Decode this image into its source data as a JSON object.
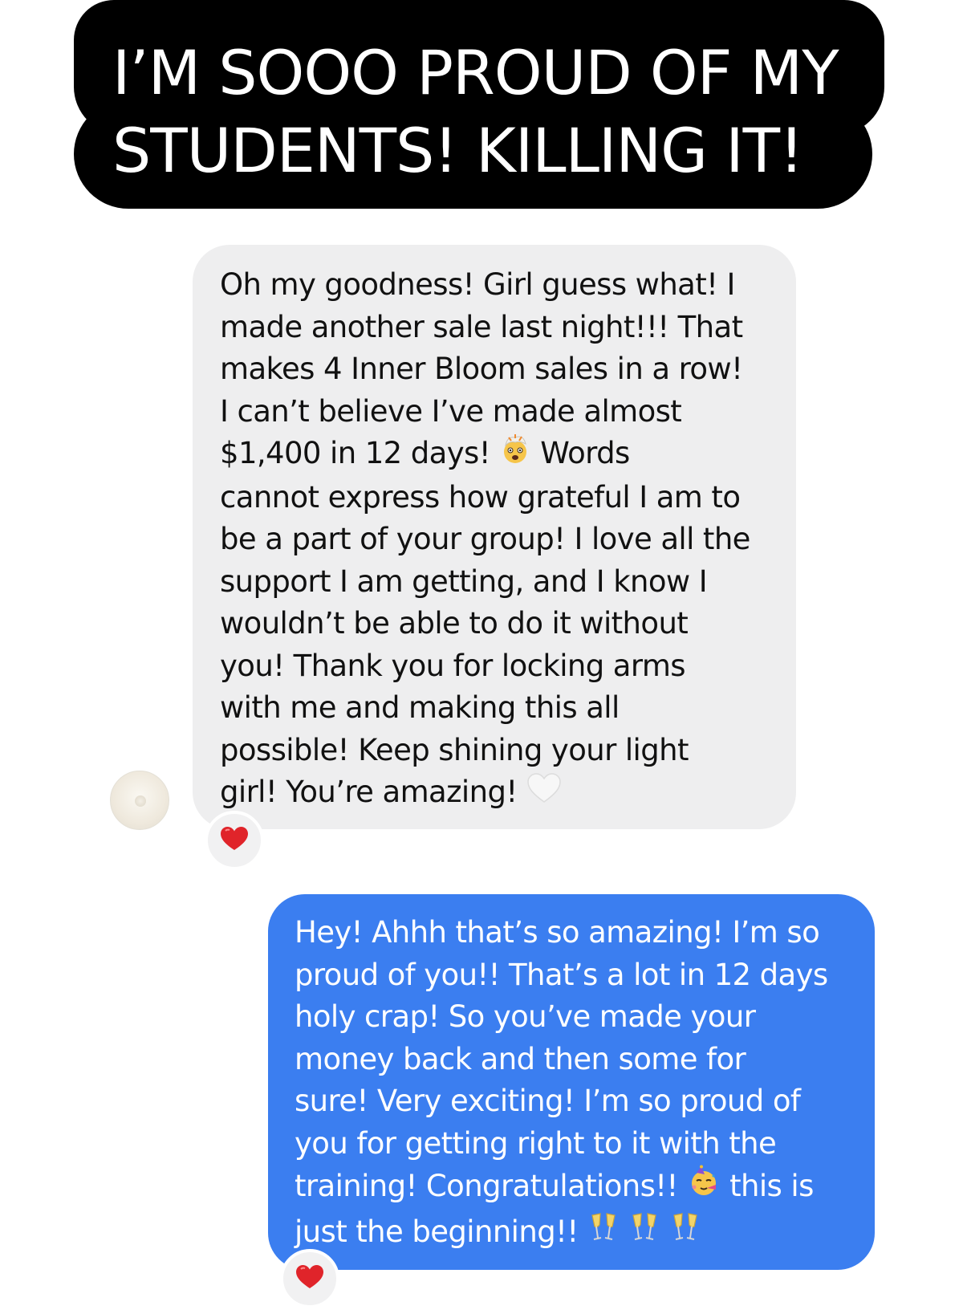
{
  "caption": {
    "line1": "I’M SOOO PROUD OF MY",
    "line2": "STUDENTS! KILLING IT!"
  },
  "conversation": {
    "incoming": {
      "lines": [
        "Oh my goodness! Girl guess what! I",
        "made another sale last night!!! That",
        "makes 4 Inner Bloom sales in a row!",
        "I can’t believe I’ve made almost",
        "$1,400 in 12 days!",
        "Words",
        "cannot express how grateful I am to",
        "be a part of your group! I love all the",
        "support I am getting, and I know I",
        "wouldn’t be able to do it without",
        "you! Thank you for locking arms",
        "with me and making this all",
        "possible! Keep shining your light",
        "girl! You’re amazing!"
      ],
      "emojis": [
        "exploding-head-emoji",
        "white-heart-emoji"
      ],
      "reaction": "red-heart-icon"
    },
    "outgoing": {
      "lines": [
        "Hey! Ahhh that’s so amazing! I’m so",
        "proud of you!! That’s a lot in 12 days",
        "holy crap! So you’ve made your",
        "money back and then some for",
        "sure! Very exciting! I’m so proud of",
        "you for getting right to it with the",
        "training! Congratulations!!",
        "this is",
        "just the beginning!!"
      ],
      "emojis": [
        "partying-face-emoji",
        "clinking-glasses-emoji"
      ],
      "reaction": "red-heart-icon"
    }
  },
  "colors": {
    "caption_bg": "#000000",
    "caption_text": "#ffffff",
    "incoming_bg": "#eeeeef",
    "outgoing_bg": "#3b7ef0",
    "heart": "#e0242a"
  }
}
